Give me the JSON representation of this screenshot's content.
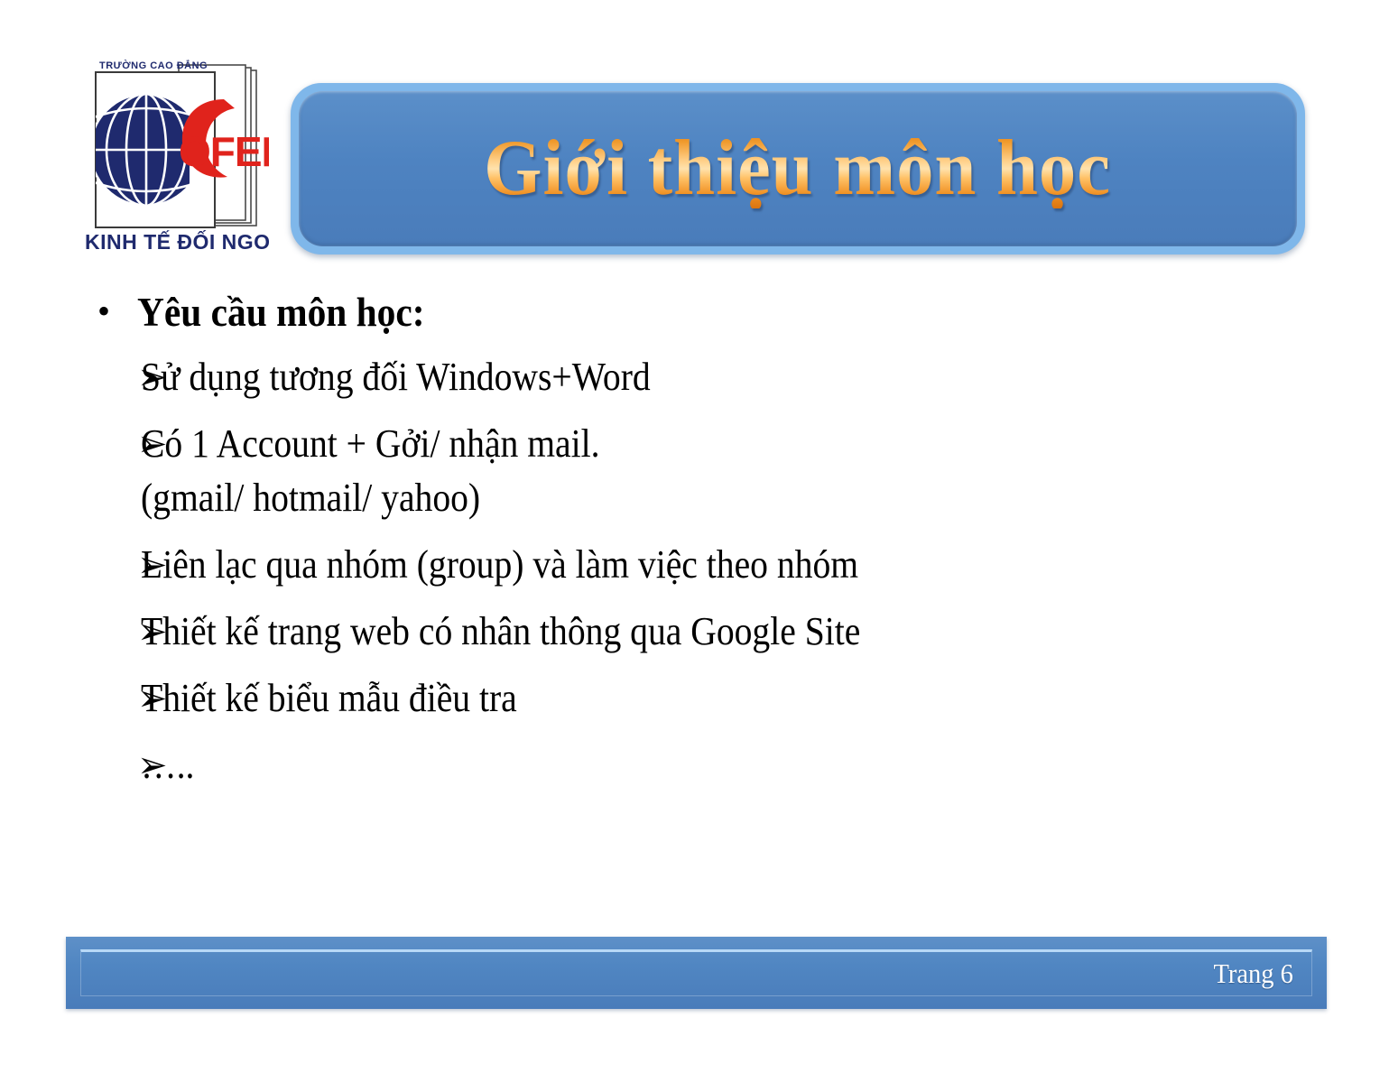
{
  "slide": {
    "background_color": "#ffffff",
    "title": "Giới thiệu môn học",
    "accent_blue": "#4e83c1",
    "accent_light_blue": "#7fb7ea",
    "title_gradient_from": "#e07b14",
    "title_gradient_to": "#ffe2ad"
  },
  "logo": {
    "top_text": "TRƯỜNG CAO ĐẲNG",
    "brand_text": "COFER",
    "bottom_text": "KINH TẾ ĐỐI NGOẠI",
    "globe_color": "#1f2a6e",
    "brand_color": "#e0231c"
  },
  "content": {
    "heading": {
      "marker": "•",
      "text": "Yêu cầu môn học:"
    },
    "items": [
      {
        "marker": "➢",
        "text": "Sử dụng tương đối Windows+Word",
        "continuation": ""
      },
      {
        "marker": "➢",
        "text": "Có 1 Account + Gởi/ nhận mail.",
        "continuation": "(gmail/ hotmail/ yahoo)"
      },
      {
        "marker": "➢",
        "text": "Liên lạc qua nhóm (group) và làm việc theo nhóm",
        "continuation": ""
      },
      {
        "marker": "➢",
        "text": "Thiết kế trang web có nhân thông qua Google Site",
        "continuation": ""
      },
      {
        "marker": "➢",
        "text": "Thiết kế biểu mẫu điều tra",
        "continuation": ""
      },
      {
        "marker": "➢",
        "text": "…..",
        "continuation": ""
      }
    ]
  },
  "footer": {
    "page_label": "Trang 6"
  }
}
